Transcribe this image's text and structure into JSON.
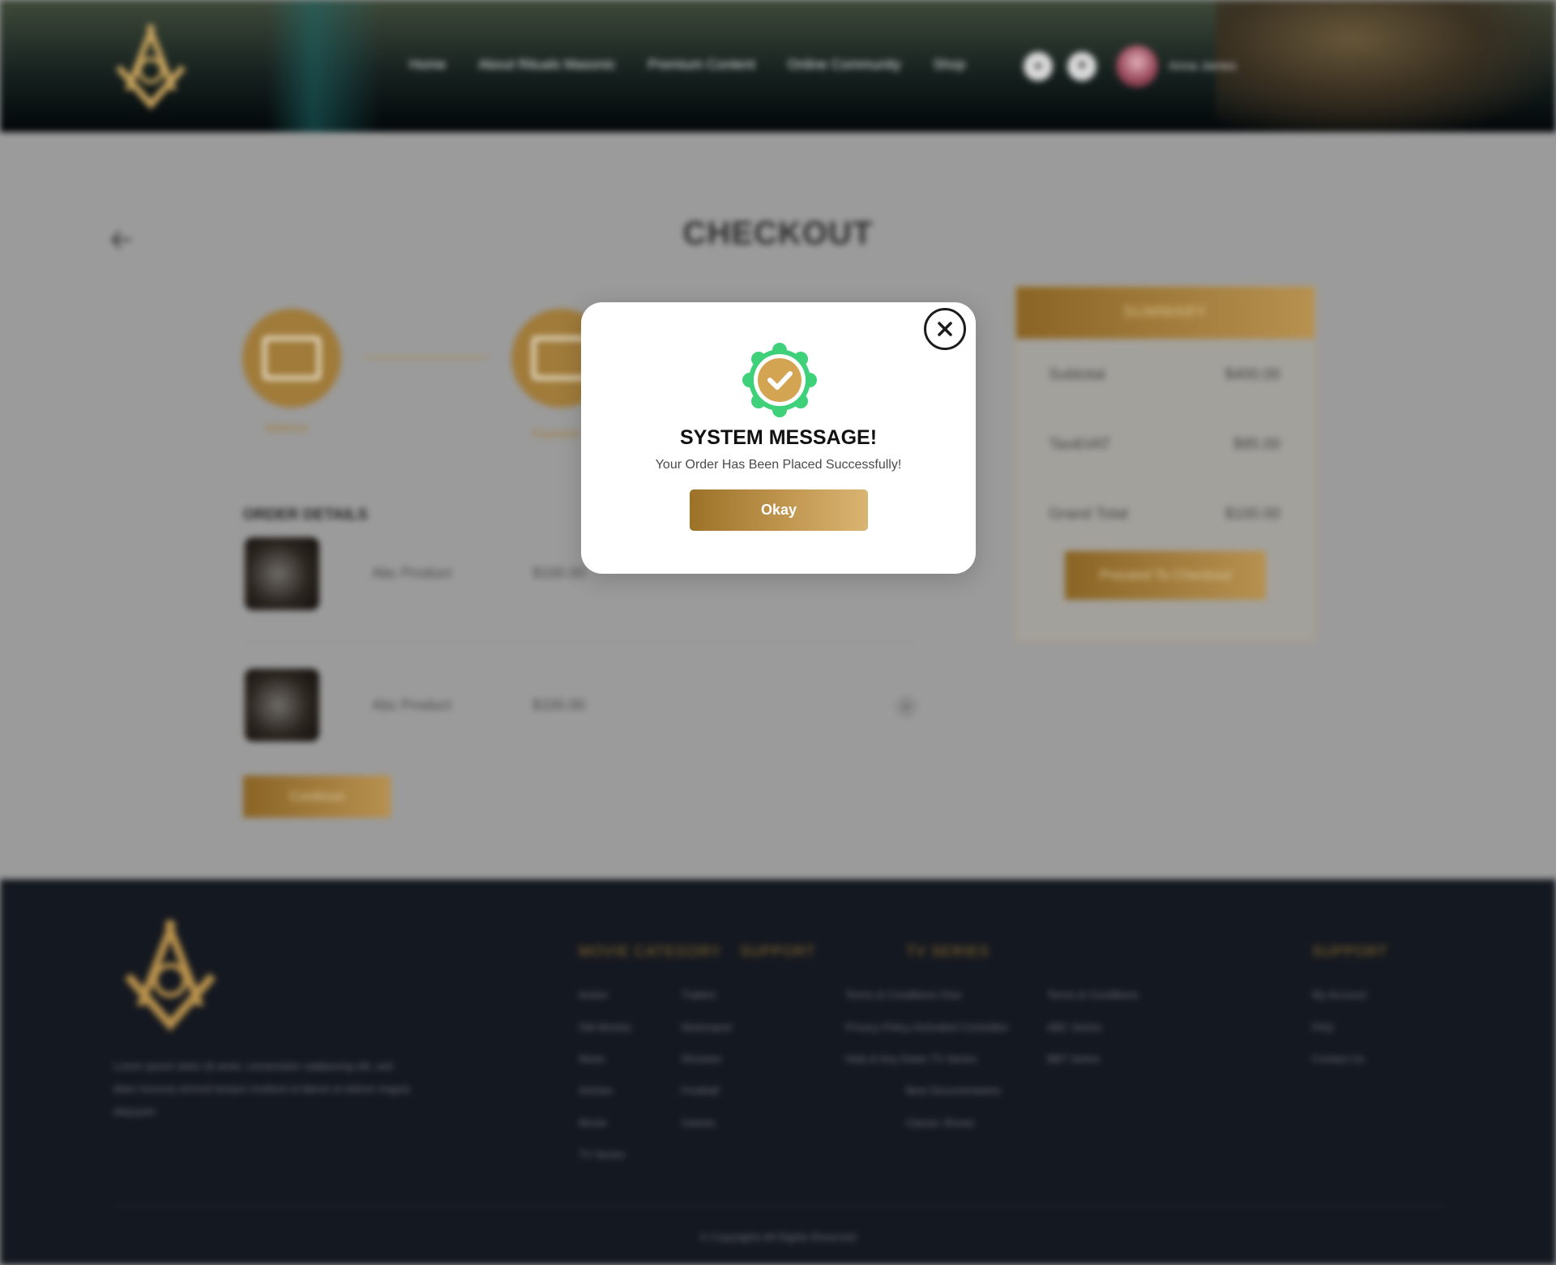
{
  "header": {
    "nav": [
      "Home",
      "About Rituals Masonic",
      "Premium Content",
      "Online Community",
      "Shop"
    ],
    "user_name": "Anna James"
  },
  "checkout": {
    "title": "CHECKOUT",
    "steps": [
      "Address",
      "Payment"
    ],
    "order_details_title": "ORDER DETAILS",
    "products": [
      {
        "name": "Abc Product",
        "price": "$100.00"
      },
      {
        "name": "Abc Product",
        "price": "$100.00"
      }
    ],
    "continue_label": "Continue"
  },
  "summary": {
    "title": "SUMMARY",
    "rows": [
      {
        "label": "Subtotal",
        "value": "$400.00"
      },
      {
        "label": "Tax&VAT",
        "value": "$95.00"
      },
      {
        "label": "Grand Total",
        "value": "$100.00"
      }
    ],
    "proceed_label": "Proceed To Checkout"
  },
  "footer": {
    "about_text": "Lorem ipsum dolor sit amet, consectetur sadipscing elit, sed diam nonumy eirmod tempor invidunt ut labore et dolore magna aliquyam",
    "col_movie_category": {
      "title": "MOVIE CATEGORY",
      "links_a": [
        "Action",
        "Old Movies",
        "News",
        "Articles",
        "Movie",
        "TV Series"
      ],
      "links_b": [
        "Trailers",
        "Motorsport",
        "Reviews",
        "Football",
        "Games"
      ]
    },
    "col_support_mid": {
      "title": "SUPPORT",
      "links": [
        "Terms & Conditions Clue",
        "Privacy Policy Animated Comedies",
        "Help & Key Dawn TV Series"
      ]
    },
    "col_tv_series": {
      "title": "TV SERIES",
      "links_a": [
        "Best Documentaries",
        "Classic Shows"
      ],
      "links_b": [
        "Terms & Conditions",
        "ABC Series",
        "BBT Series"
      ]
    },
    "col_support_right": {
      "title": "SUPPORT",
      "links": [
        "My Account",
        "FAQ",
        "Contact Us"
      ]
    },
    "copyright": "© Copyrights All Rights Reserved"
  },
  "modal": {
    "title": "SYSTEM MESSAGE!",
    "message": "Your Order Has Been Placed Successfully!",
    "okay_label": "Okay"
  },
  "colors": {
    "gold": "#b79150",
    "gold_dark": "#8a6424",
    "badge_green": "#3fd17a",
    "footer_bg": "#141820"
  }
}
